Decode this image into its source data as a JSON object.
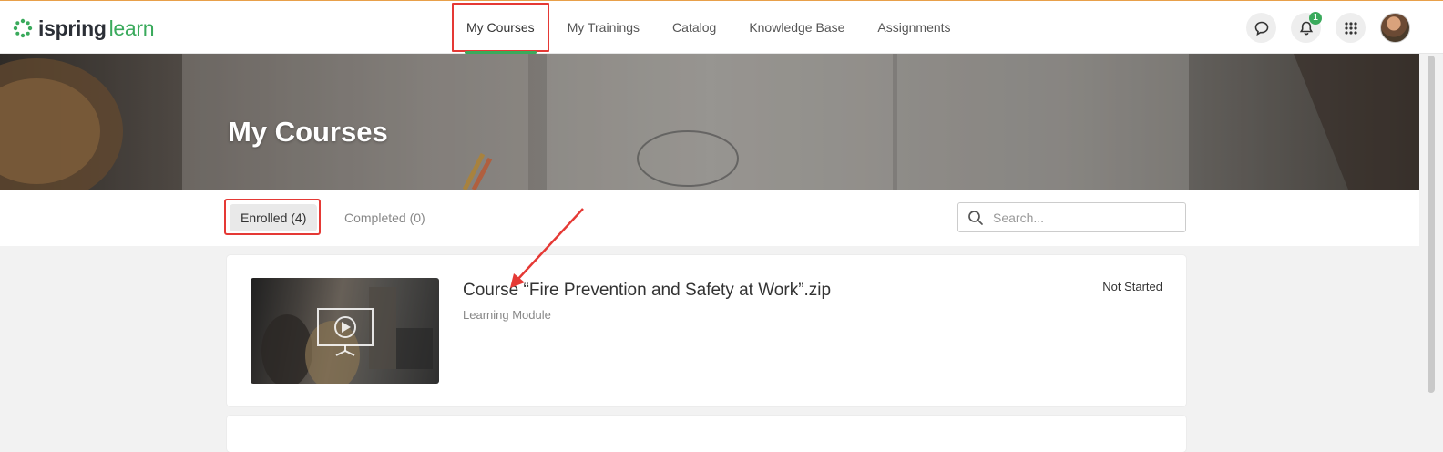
{
  "logo": {
    "brand_a": "ispring",
    "brand_b": "learn"
  },
  "nav": {
    "items": [
      {
        "label": "My Courses",
        "active": true
      },
      {
        "label": "My Trainings"
      },
      {
        "label": "Catalog"
      },
      {
        "label": "Knowledge Base"
      },
      {
        "label": "Assignments"
      }
    ]
  },
  "top_icons": {
    "chat": "chat-icon",
    "notifications": "bell-icon",
    "notifications_count": "1",
    "apps": "apps-grid-icon"
  },
  "hero": {
    "title": "My Courses"
  },
  "tabs": {
    "enrolled": "Enrolled (4)",
    "completed": "Completed (0)"
  },
  "search": {
    "placeholder": "Search..."
  },
  "courses": [
    {
      "title": "Course “Fire Prevention and Safety at Work”.zip",
      "type": "Learning Module",
      "status": "Not Started"
    }
  ],
  "colors": {
    "accent": "#3aaa5c",
    "highlight": "#e53935"
  }
}
